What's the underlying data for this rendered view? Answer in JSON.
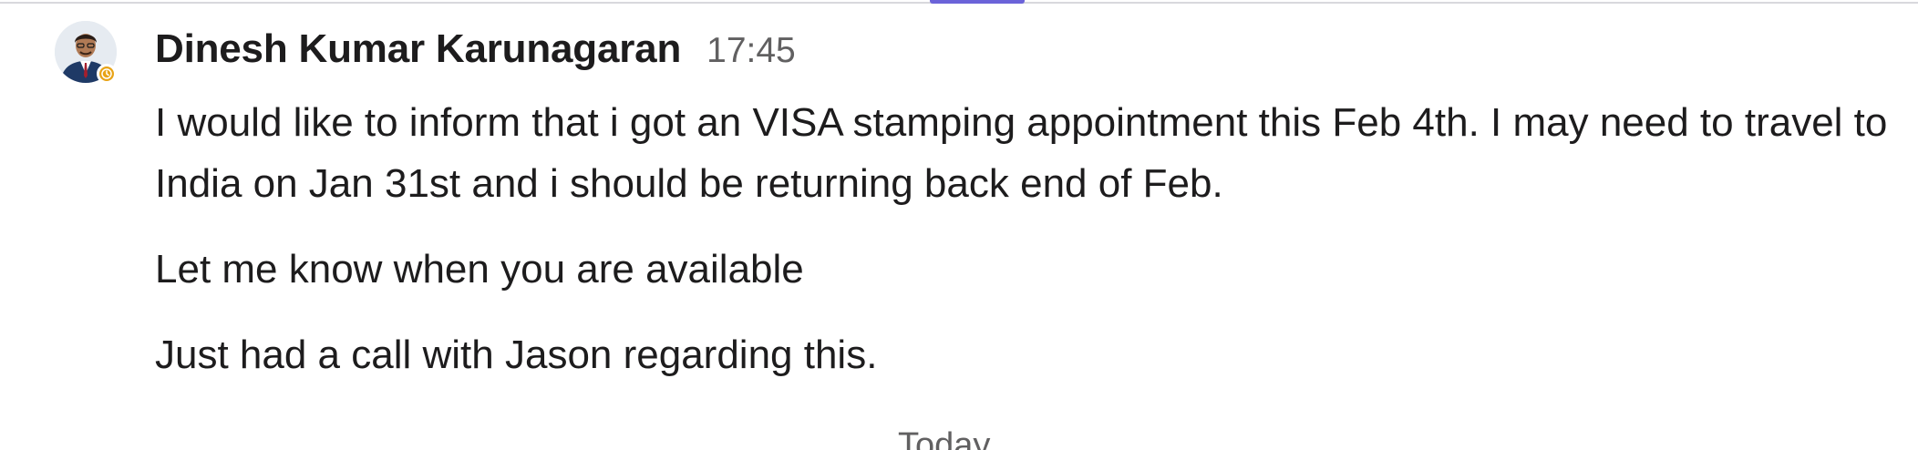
{
  "message": {
    "sender_name": "Dinesh Kumar Karunagaran",
    "timestamp": "17:45",
    "avatar": {
      "icon": "user-avatar-icon",
      "status": "away",
      "status_icon": "clock-icon",
      "status_color": "#e8a316"
    },
    "paragraphs": [
      "I would like to inform that i got an VISA stamping appointment this Feb 4th. I may need to travel to India on Jan 31st and i should be returning back end of Feb.",
      "Let me know when you are available",
      "Just had a call with Jason regarding this."
    ]
  },
  "date_divider": {
    "label": "Today"
  },
  "colors": {
    "accent": "#6b63d9",
    "text": "#1d1c1d",
    "muted": "#616061"
  }
}
